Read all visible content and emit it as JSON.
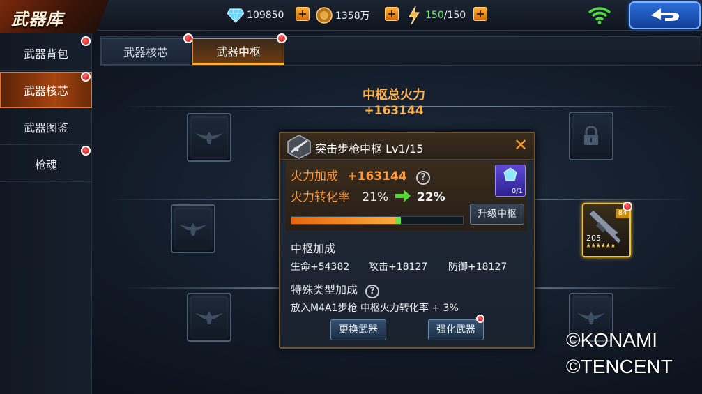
{
  "header": {
    "title": "武器库",
    "diamonds": "109850",
    "gold": "1358万",
    "stamina_current": "150",
    "stamina_max": "/150",
    "plus_symbol": "+"
  },
  "sidebar": {
    "items": [
      {
        "label": "武器背包",
        "active": false,
        "badge": true
      },
      {
        "label": "武器核芯",
        "active": true,
        "badge": true
      },
      {
        "label": "武器图鉴",
        "active": false,
        "badge": false
      },
      {
        "label": "枪魂",
        "active": false,
        "badge": true
      }
    ]
  },
  "tabs": [
    {
      "label": "武器核芯",
      "active": false
    },
    {
      "label": "武器中枢",
      "active": true
    }
  ],
  "hub": {
    "total_label": "中枢总火力",
    "total_value": "+163144",
    "equipped_weapon": {
      "level_badge": "84",
      "power": "205",
      "stars": 6
    }
  },
  "popup": {
    "title": "突击步枪中枢",
    "level": "Lv1/15",
    "close": "✕",
    "fire_bonus_label": "火力加成",
    "fire_bonus_value": "+163144",
    "help": "?",
    "conversion_label": "火力转化率",
    "conversion_from": "21%",
    "conversion_to": "22%",
    "material_count": "0/1",
    "upgrade_button": "升级中枢",
    "progress": 0.64,
    "hub_bonus_title": "中枢加成",
    "stats": [
      {
        "label": "生命",
        "value": "+54382"
      },
      {
        "label": "攻击",
        "value": "+18127"
      },
      {
        "label": "防御",
        "value": "+18127"
      }
    ],
    "special_title": "特殊类型加成",
    "special_text": "放入M4A1步枪 中枢火力转化率 + 3%",
    "replace_button": "更换武器",
    "enhance_button": "强化武器"
  },
  "watermark": {
    "line1": "©KONAMI",
    "line2": "©TENCENT"
  },
  "colors": {
    "accent_orange": "#ff9a3c",
    "gold_value": "#ffb14a",
    "stamina_green": "#6cf06a",
    "badge_red": "#e01818"
  }
}
